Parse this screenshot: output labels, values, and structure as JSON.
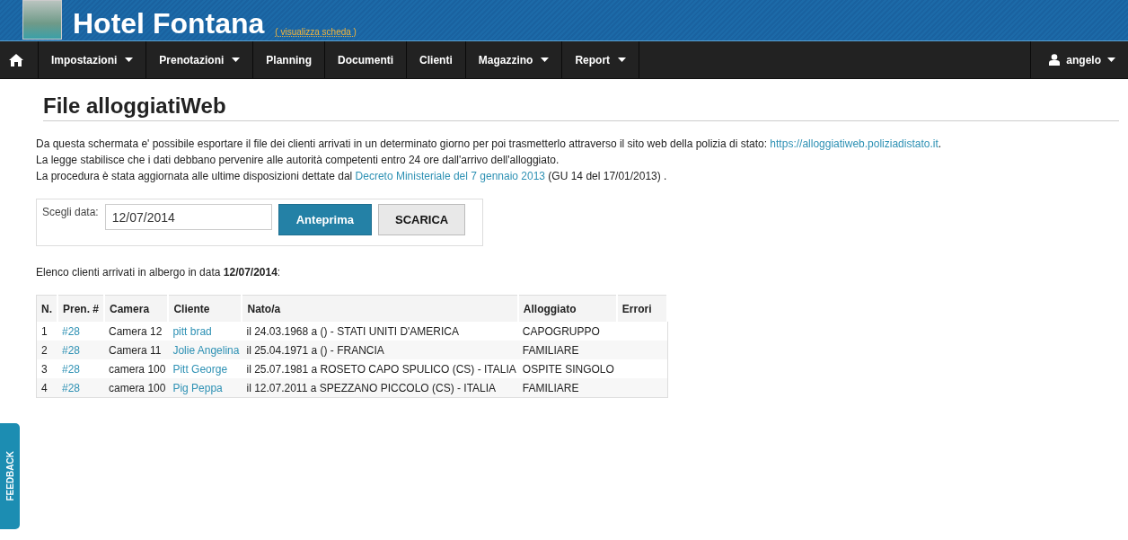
{
  "header": {
    "title": "Hotel Fontana",
    "link": "( visualizza scheda )"
  },
  "nav": {
    "items": [
      {
        "label": "Impostazioni",
        "dropdown": true
      },
      {
        "label": "Prenotazioni",
        "dropdown": true
      },
      {
        "label": "Planning",
        "dropdown": false
      },
      {
        "label": "Documenti",
        "dropdown": false
      },
      {
        "label": "Clienti",
        "dropdown": false
      },
      {
        "label": "Magazzino",
        "dropdown": true
      },
      {
        "label": "Report",
        "dropdown": true
      }
    ],
    "user": "angelo"
  },
  "page_title": "File alloggiatiWeb",
  "intro": [
    {
      "before": "Da questa schermata e' possibile esportare il file dei clienti arrivati in un determinato giorno per poi trasmetterlo attraverso il sito web della polizia di stato: ",
      "link": "https://alloggiatiweb.poliziadistato.it",
      "after": "."
    },
    {
      "before": "La legge stabilisce che i dati debbano pervenire alle autorità competenti entro 24 ore dall'arrivo dell'alloggiato."
    },
    {
      "before": "La procedura è stata aggiornata alle ultime disposizioni dettate dal ",
      "link": "Decreto Ministeriale del 7 gennaio 2013",
      "after": " (GU 14 del 17/01/2013) ."
    }
  ],
  "form": {
    "label": "Scegli data:",
    "value": "12/07/2014",
    "buttons": [
      "Anteprima",
      "SCARICA"
    ]
  },
  "list_caption": "Elenco clienti arrivati in albergo in data **12/07/2014**:",
  "table": {
    "columns": [
      "N.",
      "Pren. #",
      "Camera",
      "Cliente",
      "Nato/a",
      "Alloggiato",
      "Errori"
    ],
    "rows": [
      {
        "n": "1",
        "pren": "#28",
        "camera": "Camera 12",
        "cliente": "pitt brad",
        "nato": "il 24.03.1968 a () - STATI UNITI D'AMERICA",
        "alloggiato": "CAPOGRUPPO"
      },
      {
        "n": "2",
        "pren": "#28",
        "camera": "Camera 11",
        "cliente": "Jolie Angelina",
        "nato": "il 25.04.1971 a () - FRANCIA",
        "alloggiato": "FAMILIARE"
      },
      {
        "n": "3",
        "pren": "#28",
        "camera": "camera 100",
        "cliente": "Pitt George",
        "nato": "il 25.07.1981 a ROSETO CAPO SPULICO (CS) - ITALIA",
        "alloggiato": "OSPITE SINGOLO"
      },
      {
        "n": "4",
        "pren": "#28",
        "camera": "camera 100",
        "cliente": "Pig Peppa",
        "nato": "il 12.07.2011 a SPEZZANO PICCOLO (CS) - ITALIA",
        "alloggiato": "FAMILIARE"
      }
    ]
  },
  "feedback": "FEEDBACK"
}
